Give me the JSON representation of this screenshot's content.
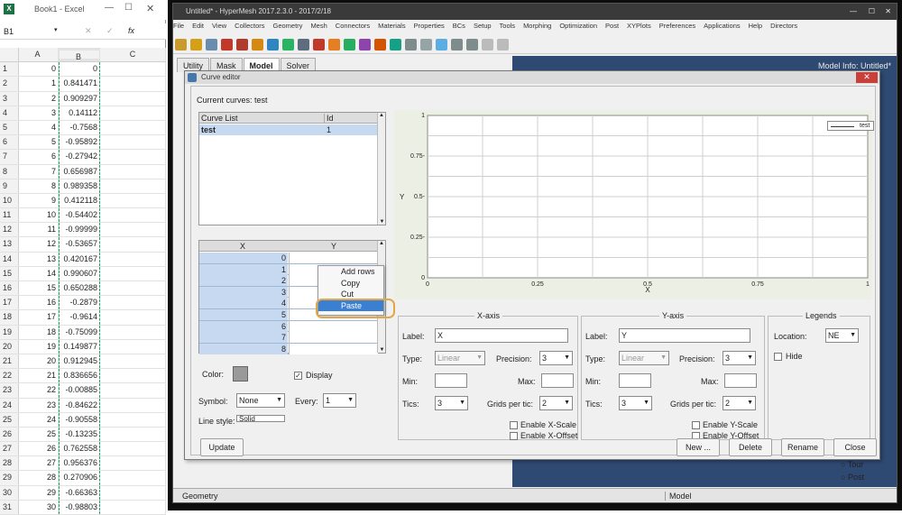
{
  "excel": {
    "title": "Book1 - Excel",
    "namebox": "B1",
    "fx": "fx",
    "columns": [
      "A",
      "B",
      "C"
    ],
    "rows": [
      {
        "r": "1",
        "a": "0",
        "b": "0"
      },
      {
        "r": "2",
        "a": "1",
        "b": "0.841471"
      },
      {
        "r": "3",
        "a": "2",
        "b": "0.909297"
      },
      {
        "r": "4",
        "a": "3",
        "b": "0.14112"
      },
      {
        "r": "5",
        "a": "4",
        "b": "-0.7568"
      },
      {
        "r": "6",
        "a": "5",
        "b": "-0.95892"
      },
      {
        "r": "7",
        "a": "6",
        "b": "-0.27942"
      },
      {
        "r": "8",
        "a": "7",
        "b": "0.656987"
      },
      {
        "r": "9",
        "a": "8",
        "b": "0.989358"
      },
      {
        "r": "10",
        "a": "9",
        "b": "0.412118"
      },
      {
        "r": "11",
        "a": "10",
        "b": "-0.54402"
      },
      {
        "r": "12",
        "a": "11",
        "b": "-0.99999"
      },
      {
        "r": "13",
        "a": "12",
        "b": "-0.53657"
      },
      {
        "r": "14",
        "a": "13",
        "b": "0.420167"
      },
      {
        "r": "15",
        "a": "14",
        "b": "0.990607"
      },
      {
        "r": "16",
        "a": "15",
        "b": "0.650288"
      },
      {
        "r": "17",
        "a": "16",
        "b": "-0.2879"
      },
      {
        "r": "18",
        "a": "17",
        "b": "-0.9614"
      },
      {
        "r": "19",
        "a": "18",
        "b": "-0.75099"
      },
      {
        "r": "20",
        "a": "19",
        "b": "0.149877"
      },
      {
        "r": "21",
        "a": "20",
        "b": "0.912945"
      },
      {
        "r": "22",
        "a": "21",
        "b": "0.836656"
      },
      {
        "r": "23",
        "a": "22",
        "b": "-0.00885"
      },
      {
        "r": "24",
        "a": "23",
        "b": "-0.84622"
      },
      {
        "r": "25",
        "a": "24",
        "b": "-0.90558"
      },
      {
        "r": "26",
        "a": "25",
        "b": "-0.13235"
      },
      {
        "r": "27",
        "a": "26",
        "b": "0.762558"
      },
      {
        "r": "28",
        "a": "27",
        "b": "0.956376"
      },
      {
        "r": "29",
        "a": "28",
        "b": "0.270906"
      },
      {
        "r": "30",
        "a": "29",
        "b": "-0.66363"
      },
      {
        "r": "31",
        "a": "30",
        "b": "-0.98803"
      }
    ]
  },
  "hypermesh": {
    "title": "Untitled* - HyperMesh 2017.2.3.0 - 2017/2/18",
    "menu": [
      "File",
      "Edit",
      "View",
      "Collectors",
      "Geometry",
      "Mesh",
      "Connectors",
      "Materials",
      "Properties",
      "BCs",
      "Setup",
      "Tools",
      "Morphing",
      "Optimization",
      "Post",
      "XYPlots",
      "Preferences",
      "Applications",
      "Help",
      "Directors"
    ],
    "tabs": [
      "Utility",
      "Mask",
      "Model",
      "Solver"
    ],
    "active_tab": "Model",
    "model_info": "Model Info: Untitled*",
    "status_left": "Geometry",
    "status_mid": "Model",
    "radio_tour": "Tour",
    "radio_post": "Post"
  },
  "dialog": {
    "title": "Curve editor",
    "current_curves": "Current curves: test",
    "curve_list_header": "Curve List",
    "id_header": "Id",
    "curves": [
      {
        "name": "test",
        "id": "1"
      }
    ],
    "xy_headers": [
      "X",
      "Y"
    ],
    "xy_rows": [
      "0",
      "1",
      "2",
      "3",
      "4",
      "5",
      "6",
      "7",
      "8"
    ],
    "context_menu": [
      "Add rows",
      "Copy",
      "Cut",
      "Paste"
    ],
    "color_label": "Color:",
    "display_label": "Display",
    "symbol_label": "Symbol:",
    "symbol_value": "None",
    "every_label": "Every:",
    "every_value": "1",
    "line_style_label": "Line style:",
    "line_style_value": "Solid",
    "xaxis": {
      "group": "X-axis",
      "label_label": "Label:",
      "label_value": "X",
      "type_label": "Type:",
      "type_value": "Linear",
      "precision_label": "Precision:",
      "precision_value": "3",
      "min_label": "Min:",
      "max_label": "Max:",
      "tics_label": "Tics:",
      "tics_value": "3",
      "grids_label": "Grids per tic:",
      "grids_value": "2",
      "enable_scale": "Enable X-Scale",
      "enable_offset": "Enable X-Offset"
    },
    "yaxis": {
      "group": "Y-axis",
      "label_label": "Label:",
      "label_value": "Y",
      "type_label": "Type:",
      "type_value": "Linear",
      "precision_label": "Precision:",
      "precision_value": "3",
      "min_label": "Min:",
      "max_label": "Max:",
      "tics_label": "Tics:",
      "tics_value": "3",
      "grids_label": "Grids per tic:",
      "grids_value": "2",
      "enable_scale": "Enable Y-Scale",
      "enable_offset": "Enable Y-Offset"
    },
    "legends": {
      "group": "Legends",
      "location_label": "Location:",
      "location_value": "NE",
      "hide_label": "Hide"
    },
    "buttons": {
      "update": "Update",
      "new": "New ...",
      "delete": "Delete",
      "rename": "Rename",
      "close": "Close"
    }
  },
  "chart_data": {
    "type": "line",
    "title": "",
    "xlabel": "X",
    "ylabel": "Y",
    "xlim": [
      0,
      1
    ],
    "ylim": [
      0,
      1
    ],
    "x_ticks": [
      "0",
      "0.25",
      "0.5",
      "0.75",
      "1"
    ],
    "y_ticks": [
      "0",
      "0.25-",
      "0.5-",
      "0.75-",
      "1"
    ],
    "grid": true,
    "legend_position": "top-right",
    "series": [
      {
        "name": "test",
        "x": [],
        "y": []
      }
    ]
  }
}
